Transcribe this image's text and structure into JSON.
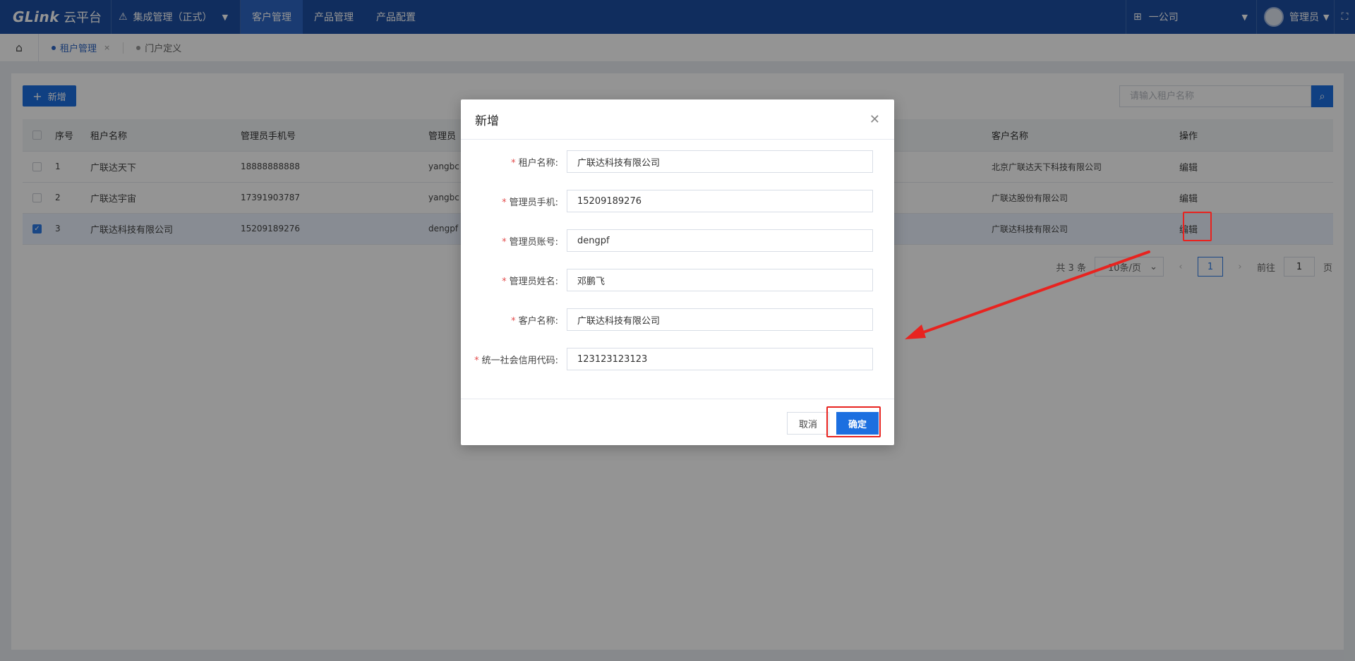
{
  "topbar": {
    "logo_brand": "GLink",
    "logo_text": "云平台",
    "module": "集成管理（正式）",
    "nav": [
      "客户管理",
      "产品管理",
      "产品配置"
    ],
    "org": "一公司",
    "user": "管理员"
  },
  "tabs": {
    "items": [
      "租户管理",
      "门户定义"
    ]
  },
  "toolbar": {
    "add_label": "新增",
    "search_placeholder": "请输入租户名称"
  },
  "table": {
    "columns": [
      "序号",
      "租户名称",
      "管理员手机号",
      "管理员",
      "客户名称",
      "操作"
    ],
    "rows": [
      {
        "index": "1",
        "name": "广联达天下",
        "phone": "18888888888",
        "admin": "yangbc",
        "customer": "北京广联达天下科技有限公司",
        "action": "编辑",
        "checked": false
      },
      {
        "index": "2",
        "name": "广联达宇宙",
        "phone": "17391903787",
        "admin": "yangbc",
        "customer": "广联达股份有限公司",
        "action": "编辑",
        "checked": false
      },
      {
        "index": "3",
        "name": "广联达科技有限公司",
        "phone": "15209189276",
        "admin": "dengpf",
        "customer": "广联达科技有限公司",
        "action": "编辑",
        "checked": true
      }
    ]
  },
  "pager": {
    "total": "共 3 条",
    "page_size": "10条/页",
    "current": "1",
    "goto_label": "前往",
    "goto_value": "1",
    "page_unit": "页"
  },
  "modal": {
    "title": "新增",
    "fields": [
      {
        "label": "租户名称:",
        "value": "广联达科技有限公司"
      },
      {
        "label": "管理员手机:",
        "value": "15209189276"
      },
      {
        "label": "管理员账号:",
        "value": "dengpf"
      },
      {
        "label": "管理员姓名:",
        "value": "邓鹏飞"
      },
      {
        "label": "客户名称:",
        "value": "广联达科技有限公司"
      },
      {
        "label": "统一社会信用代码:",
        "value": "123123123123"
      }
    ],
    "cancel_label": "取消",
    "ok_label": "确定"
  },
  "colors": {
    "topbar": "#1c4fa3",
    "primary": "#1c6fe0",
    "link": "#2d7be5",
    "annotation": "#e8231f"
  }
}
